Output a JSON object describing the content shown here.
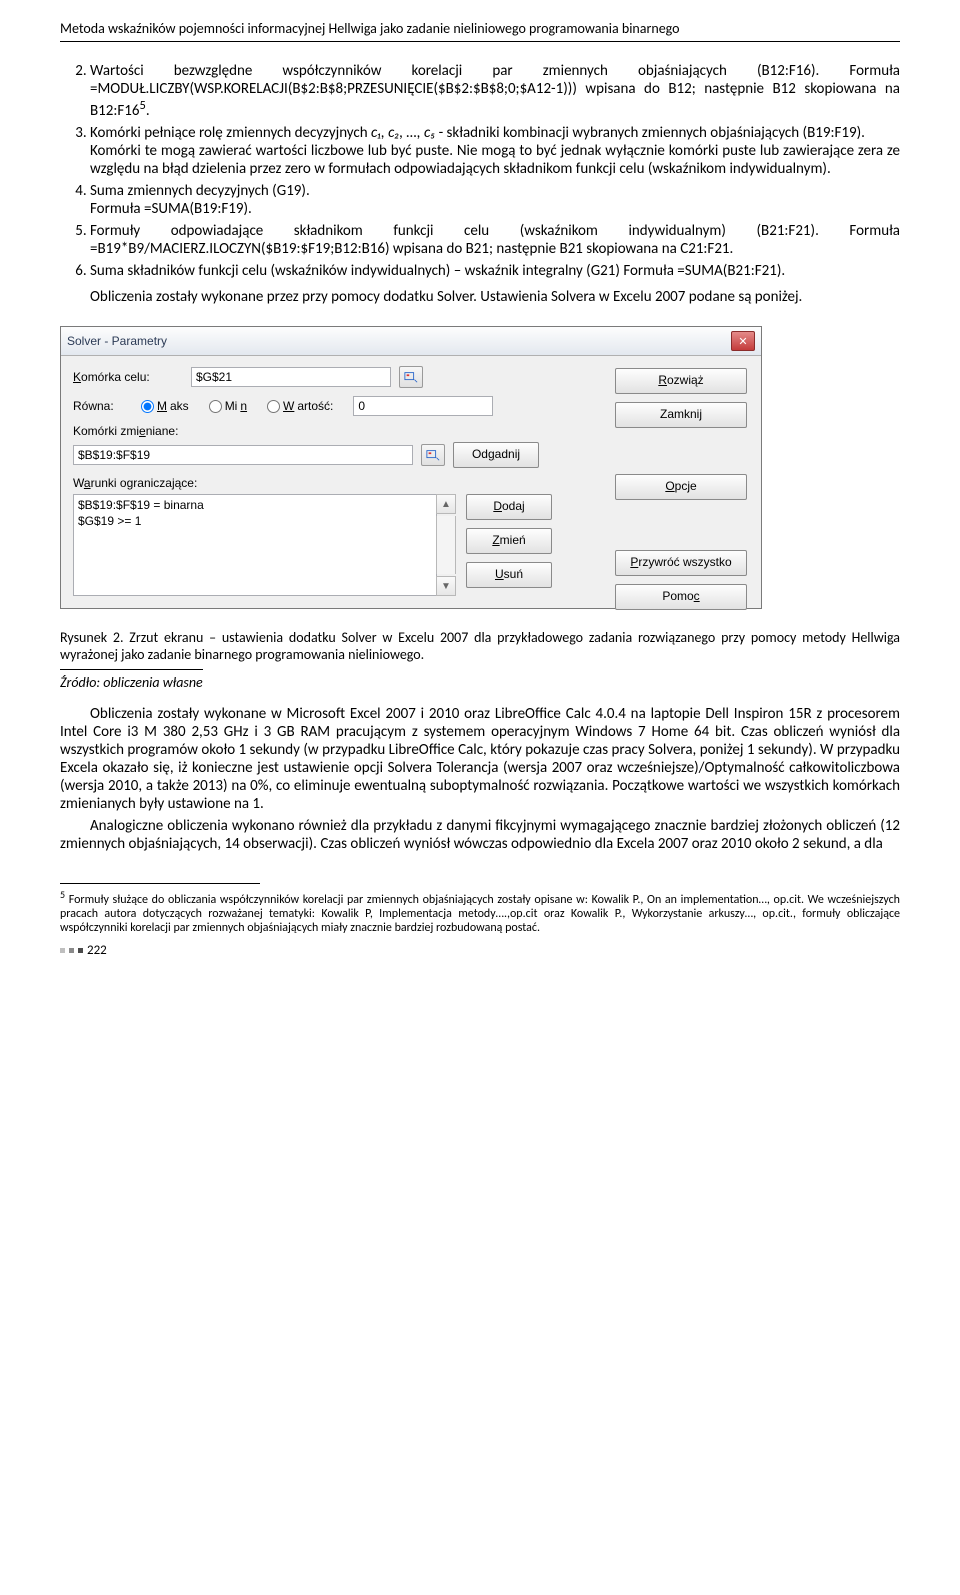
{
  "running_head": "Metoda wskaźników pojemności informacyjnej Hellwiga jako zadanie nieliniowego programowania binarnego",
  "list": {
    "i2": {
      "a": "Wartości bezwzględne współczynników korelacji par zmiennych objaśniających (B12:F16). Formuła =MODUŁ.LICZBY(WSP.KORELACJI(B$2:B$8;PRZESUNIĘCIE($B$2:$B$8;0;$A12-1))) wpisana do B12; następnie B12 skopiowana na B12:F16",
      "sup": "5",
      "dot": "."
    },
    "i3": {
      "a": "Komórki pełniące rolę zmiennych decyzyjnych ",
      "math": "c₁, c₂, …, c₅",
      "b": " - składniki kombinacji wybranych zmiennych objaśniających (B19:F19).",
      "c": "Komórki te mogą zawierać wartości liczbowe lub być puste. Nie mogą to być jednak wyłącznie komórki puste lub zawierające zera ze względu na błąd dzielenia przez zero w formułach odpowiadających składnikom funkcji celu (wskaźnikom indywidualnym)."
    },
    "i4": {
      "a": "Suma zmiennych decyzyjnych (G19).",
      "b": "Formuła =SUMA(B19:F19)."
    },
    "i5": {
      "a": "Formuły odpowiadające składnikom funkcji celu (wskaźnikom indywidualnym) (B21:F21). Formuła =B19*B9/MACIERZ.ILOCZYN($B19:$F19;B12:B16) wpisana do B21; następnie B21 skopiowana na C21:F21."
    },
    "i6": {
      "a": "Suma składników funkcji celu (wskaźników indywidualnych) – wskaźnik integralny (G21) Formuła =SUMA(B21:F21)."
    }
  },
  "after_list": "Obliczenia zostały wykonane przez przy pomocy dodatku Solver. Ustawienia Solvera w Excelu 2007 podane są poniżej.",
  "solver": {
    "title": "Solver - Parametry",
    "lbl_target": "Komórka celu:",
    "target_val": "$G$21",
    "lbl_eq": "Równa:",
    "opt_max": "Maks",
    "opt_min": "Min",
    "opt_val": "Wartość:",
    "value_field": "0",
    "lbl_changing": "Komórki zmieniane:",
    "changing_val": "$B$19:$F$19",
    "btn_guess": "Odgadnij",
    "lbl_constraints": "Warunki ograniczające:",
    "constraint1": "$B$19:$F$19 = binarna",
    "constraint2": "$G$19 >= 1",
    "btn_add": "Dodaj",
    "btn_change": "Zmień",
    "btn_delete": "Usuń",
    "btn_solve": "Rozwiąż",
    "btn_close": "Zamknij",
    "btn_options": "Opcje",
    "btn_reset": "Przywróć wszystko",
    "btn_help": "Pomoc"
  },
  "caption": "Rysunek 2. Zrzut ekranu – ustawienia dodatku Solver w Excelu 2007 dla przykładowego zadania rozwiązanego przy pomocy metody Hellwiga wyrażonej jako zadanie binarnego programowania nieliniowego.",
  "source": "Źródło: obliczenia własne",
  "para1": "Obliczenia zostały wykonane w Microsoft Excel 2007 i 2010 oraz LibreOffice Calc 4.0.4 na laptopie Dell Inspiron 15R z procesorem Intel Core i3 M 380 2,53 GHz i 3 GB RAM pracującym z systemem operacyjnym Windows 7 Home 64 bit. Czas obliczeń wyniósł dla wszystkich programów około 1 sekundy (w przypadku LibreOffice Calc, który pokazuje czas pracy Solvera, poniżej 1 sekundy). W przypadku Excela okazało się, iż konieczne jest ustawienie opcji Solvera Tolerancja (wersja 2007 oraz wcześniejsze)/Optymalność całkowitoliczbowa (wersja 2010, a także 2013) na 0%, co eliminuje ewentualną suboptymalność rozwiązania. Początkowe wartości we wszystkich komórkach zmienianych były ustawione na 1.",
  "para2": "Analogiczne obliczenia wykonano również dla przykładu z danymi fikcyjnymi wymagającego znacznie bardziej złożonych obliczeń (12 zmiennych objaśniających, 14 obserwacji). Czas obliczeń wyniósł wówczas odpowiednio dla Excela 2007 oraz 2010 około 2 sekund, a dla",
  "footnote": {
    "num": "5",
    "text": " Formuły służące do obliczania współczynników korelacji par zmiennych objaśniających zostały opisane w: Kowalik P., On an implementation…, op.cit. We wcześniejszych pracach autora dotyczących rozważanej tematyki: Kowalik P, Implementacja metody….,op.cit oraz Kowalik P., Wykorzystanie arkuszy…, op.cit., formuły obliczające współczynniki korelacji par zmiennych objaśniających miały znacznie bardziej rozbudowaną postać."
  },
  "page_number": "222"
}
